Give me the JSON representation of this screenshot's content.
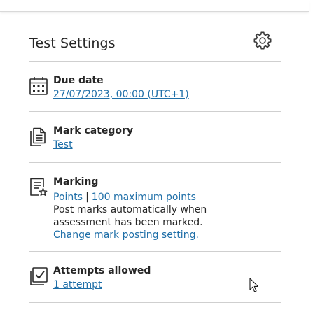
{
  "panel": {
    "title": "Test Settings",
    "settings_icon": "gear-icon"
  },
  "due_date": {
    "icon": "calendar-icon",
    "label": "Due date",
    "value": "27/07/2023, 00:00 (UTC+1)"
  },
  "mark_category": {
    "icon": "document-icon",
    "label": "Mark category",
    "value": "Test"
  },
  "marking": {
    "icon": "marking-list-icon",
    "label": "Marking",
    "scheme": "Points",
    "separator": "|",
    "max_points": "100 maximum points",
    "description": "Post marks automatically when assessment has been marked.",
    "change_link": "Change mark posting setting."
  },
  "attempts": {
    "icon": "checkbox-attempts-icon",
    "label": "Attempts allowed",
    "value": "1 attempt"
  },
  "colors": {
    "link": "#1f6fa8",
    "text": "#262626",
    "divider": "#cfcfcf"
  }
}
